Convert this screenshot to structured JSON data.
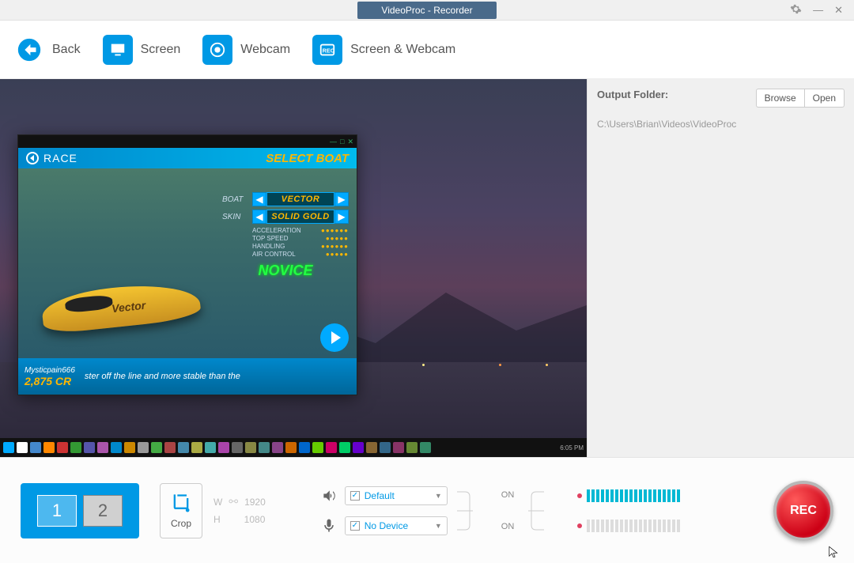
{
  "titlebar": {
    "title": "VideoProc - Recorder"
  },
  "toolbar": {
    "back": "Back",
    "screen": "Screen",
    "webcam": "Webcam",
    "screen_webcam": "Screen & Webcam"
  },
  "sidebar": {
    "output_label": "Output Folder:",
    "browse": "Browse",
    "open": "Open",
    "path": "C:\\Users\\Brian\\Videos\\VideoProc"
  },
  "preview": {
    "game": {
      "race_label": "RACE",
      "select_boat": "SELECT BOAT",
      "boat_label": "BOAT",
      "boat_value": "VECTOR",
      "skin_label": "SKIN",
      "skin_value": "SOLID GOLD",
      "stats": {
        "acceleration": "ACCELERATION",
        "top_speed": "TOP SPEED",
        "handling": "HANDLING",
        "air_control": "AIR CONTROL"
      },
      "difficulty": "NOVICE",
      "username": "Mysticpain666",
      "credits": "2,875 CR",
      "description": "ster off the line and more stable than the"
    }
  },
  "bottom": {
    "monitors": {
      "one": "1",
      "two": "2"
    },
    "crop_label": "Crop",
    "dims": {
      "w_label": "W",
      "w_value": "1920",
      "h_label": "H",
      "h_value": "1080"
    },
    "audio": {
      "speaker_device": "Default",
      "mic_device": "No Device",
      "speaker_state": "ON",
      "mic_state": "ON"
    },
    "rec_label": "REC"
  }
}
